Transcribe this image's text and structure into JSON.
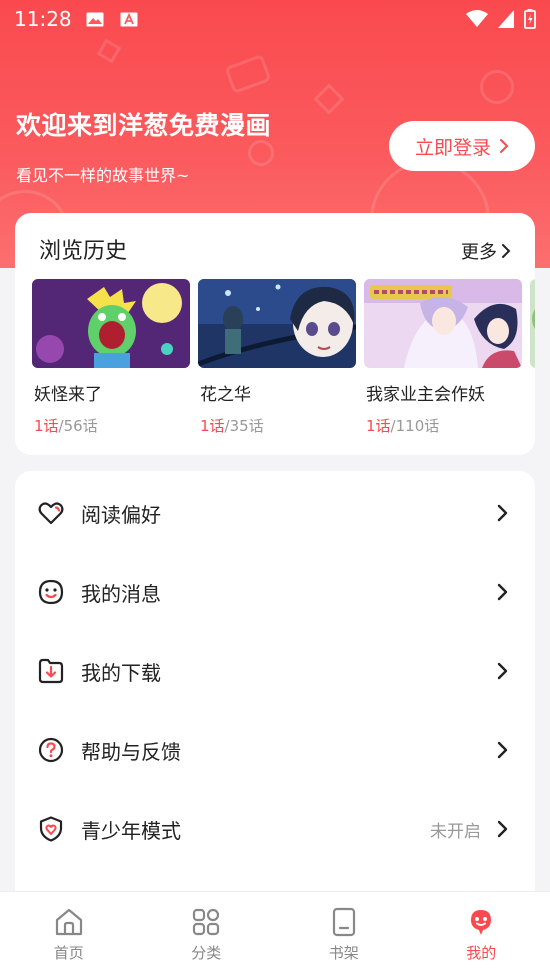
{
  "status_bar": {
    "time": "11:28",
    "left_icons": [
      "image-icon",
      "a-notification-icon"
    ],
    "right_icons": [
      "wifi-icon",
      "signal-icon",
      "battery-icon"
    ]
  },
  "header": {
    "title": "欢迎来到洋葱免费漫画",
    "subtitle": "看见不一样的故事世界~",
    "login_label": "立即登录",
    "accent_color": "#fa4a4f"
  },
  "history": {
    "title": "浏览历史",
    "more_label": "更多",
    "items": [
      {
        "title": "妖怪来了",
        "current": "1话",
        "separator": "/",
        "total": "56话"
      },
      {
        "title": "花之华",
        "current": "1话",
        "separator": "/",
        "total": "35话"
      },
      {
        "title": "我家业主会作妖",
        "current": "1话",
        "separator": "/",
        "total": "110话"
      }
    ]
  },
  "menu": {
    "items": [
      {
        "label": "阅读偏好",
        "icon": "heart-icon",
        "value": ""
      },
      {
        "label": "我的消息",
        "icon": "smiley-message-icon",
        "value": ""
      },
      {
        "label": "我的下载",
        "icon": "download-icon",
        "value": ""
      },
      {
        "label": "帮助与反馈",
        "icon": "help-icon",
        "value": ""
      },
      {
        "label": "青少年模式",
        "icon": "shield-icon",
        "value": "未开启"
      }
    ]
  },
  "tabbar": {
    "tabs": [
      {
        "label": "首页",
        "icon": "home-icon",
        "active": false
      },
      {
        "label": "分类",
        "icon": "category-icon",
        "active": false
      },
      {
        "label": "书架",
        "icon": "bookshelf-icon",
        "active": false
      },
      {
        "label": "我的",
        "icon": "profile-icon",
        "active": true
      }
    ]
  }
}
